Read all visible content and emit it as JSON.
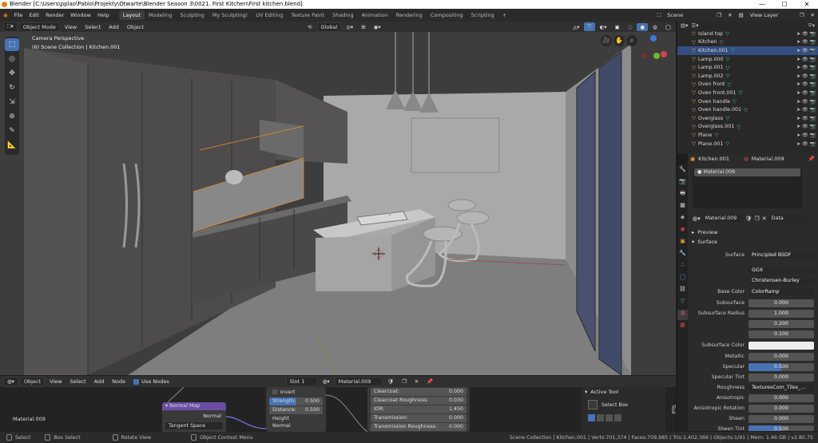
{
  "titlebar": {
    "title": "Blender [C:\\Users\\pplao\\Pablo\\Projekty\\Otwarte\\Blender Season 3\\0021. First Kitchen\\First kitchen.blend]",
    "minimize": "—",
    "maximize": "☐",
    "close": "✕"
  },
  "menu": {
    "items": [
      "File",
      "Edit",
      "Render",
      "Window",
      "Help"
    ],
    "workspaces": [
      "Layout",
      "Modeling",
      "Sculpting",
      "My Sculpting!",
      "UV Editing",
      "Texture Paint",
      "Shading",
      "Animation",
      "Rendering",
      "Compositing",
      "Scripting"
    ],
    "add_tab": "+",
    "scene": "Scene",
    "view_layer": "View Layer"
  },
  "viewport_header": {
    "mode": "Object Mode",
    "view": "View",
    "select": "Select",
    "add": "Add",
    "object": "Object",
    "orientation": "Global"
  },
  "viewport": {
    "camera_label": "Camera Perspective",
    "collection_label": "(6) Scene Collection | Kitchen.001"
  },
  "outliner": {
    "items": [
      {
        "name": "Island top",
        "selected": false
      },
      {
        "name": "Kitchen",
        "selected": false
      },
      {
        "name": "Kitchen.001",
        "selected": true
      },
      {
        "name": "Lamp.000",
        "selected": false
      },
      {
        "name": "Lamp.001",
        "selected": false
      },
      {
        "name": "Lamp.002",
        "selected": false
      },
      {
        "name": "Oven front",
        "selected": false
      },
      {
        "name": "Oven front.001",
        "selected": false
      },
      {
        "name": "Oven handle",
        "selected": false
      },
      {
        "name": "Oven handle.001",
        "selected": false
      },
      {
        "name": "Overglass",
        "selected": false
      },
      {
        "name": "Overglass.001",
        "selected": false
      },
      {
        "name": "Plane",
        "selected": false
      },
      {
        "name": "Plane.001",
        "selected": false
      }
    ]
  },
  "properties": {
    "object_name": "Kitchen.001",
    "material_name": "Material.009",
    "slot_item": "Material.009",
    "material_field": "Material.009",
    "data_label": "Data",
    "preview_label": "Preview",
    "surface_section": "Surface",
    "surface_label": "Surface",
    "surface_value": "Principled BSDF",
    "distribution": "GGX",
    "subsurface_method": "Christensen-Burley",
    "rows": [
      {
        "label": "Base Color",
        "value": "ColorRamp",
        "style": "dd"
      },
      {
        "label": "Subsurface",
        "value": "0.000",
        "style": ""
      },
      {
        "label": "Subsurface Radius",
        "value": "1.000",
        "style": ""
      },
      {
        "label": "",
        "value": "0.200",
        "style": ""
      },
      {
        "label": "",
        "value": "0.100",
        "style": ""
      },
      {
        "label": "Subsurface Color",
        "value": "",
        "style": "white"
      },
      {
        "label": "Metallic",
        "value": "0.000",
        "style": ""
      },
      {
        "label": "Specular",
        "value": "0.500",
        "style": "blue"
      },
      {
        "label": "Specular Tint",
        "value": "0.000",
        "style": ""
      },
      {
        "label": "Roughness",
        "value": "TexturesCom_Tiles_...",
        "style": "dd"
      },
      {
        "label": "Anisotropic",
        "value": "0.000",
        "style": ""
      },
      {
        "label": "Anisotropic Rotation",
        "value": "0.000",
        "style": ""
      },
      {
        "label": "Sheen",
        "value": "0.000",
        "style": ""
      },
      {
        "label": "Sheen Tint",
        "value": "0.500",
        "style": "blue"
      }
    ]
  },
  "node_header": {
    "editor": "Object",
    "view": "View",
    "select": "Select",
    "add": "Add",
    "node": "Node",
    "use_nodes": "Use Nodes",
    "slot": "Slot 1",
    "material": "Material.009"
  },
  "node_editor": {
    "material_label": "Material.009",
    "normal_map_title": "Normal Map",
    "normal_output": "Normal",
    "tangent_space": "Tangent Space",
    "bump": {
      "invert": "Invert",
      "strength_label": "Strength:",
      "strength_value": "0.500",
      "distance_label": "Distance:",
      "distance_value": "0.500",
      "height": "Height",
      "normal": "Normal"
    },
    "bsdf_rows": [
      {
        "label": "Clearcoat:",
        "value": "0.000"
      },
      {
        "label": "Clearcoat Roughness:",
        "value": "0.030"
      },
      {
        "label": "IOR:",
        "value": "1.450"
      },
      {
        "label": "Transmission:",
        "value": "0.000"
      },
      {
        "label": "Transmission Roughness:",
        "value": "0.000"
      }
    ],
    "active_tool_title": "Active Tool",
    "active_tool_name": "Select Box",
    "side_tab": "Tool"
  },
  "statusbar": {
    "select": "Select",
    "box_select": "Box Select",
    "rotate_view": "Rotate View",
    "context_menu": "Object Context Menu",
    "stats": "Scene Collection | Kitchen.001 | Verts:701,374 | Faces:709,985 | Tris:1,402,366 | Objects:1/91 | Mem: 1.46 GB | v2.80.75"
  },
  "colors": {
    "accent": "#4772b3",
    "selection": "#334d80",
    "object_icon": "#e0a030",
    "mesh_icon": "#40c0a0"
  }
}
